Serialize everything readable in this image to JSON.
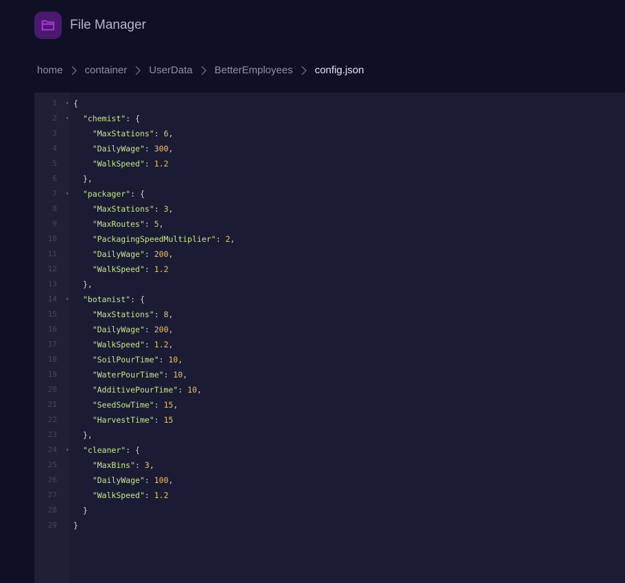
{
  "app": {
    "title": "File Manager",
    "icon": "folder-icon",
    "accent": "#a020c0"
  },
  "breadcrumb": {
    "items": [
      "home",
      "container",
      "UserData",
      "BetterEmployees"
    ],
    "current": "config.json"
  },
  "editor": {
    "lines": [
      {
        "n": "1",
        "fold": true,
        "parts": [
          {
            "t": "p",
            "v": "{"
          }
        ]
      },
      {
        "n": "2",
        "fold": true,
        "parts": [
          {
            "t": "p",
            "v": "  "
          },
          {
            "t": "k",
            "v": "\"chemist\""
          },
          {
            "t": "p",
            "v": ": {"
          }
        ]
      },
      {
        "n": "3",
        "parts": [
          {
            "t": "p",
            "v": "    "
          },
          {
            "t": "k",
            "v": "\"MaxStations\""
          },
          {
            "t": "p",
            "v": ": "
          },
          {
            "t": "n",
            "v": "6"
          },
          {
            "t": "p",
            "v": ","
          }
        ]
      },
      {
        "n": "4",
        "parts": [
          {
            "t": "p",
            "v": "    "
          },
          {
            "t": "k",
            "v": "\"DailyWage\""
          },
          {
            "t": "p",
            "v": ": "
          },
          {
            "t": "n",
            "v": "300"
          },
          {
            "t": "p",
            "v": ","
          }
        ]
      },
      {
        "n": "5",
        "parts": [
          {
            "t": "p",
            "v": "    "
          },
          {
            "t": "k",
            "v": "\"WalkSpeed\""
          },
          {
            "t": "p",
            "v": ": "
          },
          {
            "t": "n",
            "v": "1.2"
          }
        ]
      },
      {
        "n": "6",
        "parts": [
          {
            "t": "p",
            "v": "  },"
          }
        ]
      },
      {
        "n": "7",
        "fold": true,
        "parts": [
          {
            "t": "p",
            "v": "  "
          },
          {
            "t": "k",
            "v": "\"packager\""
          },
          {
            "t": "p",
            "v": ": {"
          }
        ]
      },
      {
        "n": "8",
        "parts": [
          {
            "t": "p",
            "v": "    "
          },
          {
            "t": "k",
            "v": "\"MaxStations\""
          },
          {
            "t": "p",
            "v": ": "
          },
          {
            "t": "n",
            "v": "3"
          },
          {
            "t": "p",
            "v": ","
          }
        ]
      },
      {
        "n": "9",
        "parts": [
          {
            "t": "p",
            "v": "    "
          },
          {
            "t": "k",
            "v": "\"MaxRoutes\""
          },
          {
            "t": "p",
            "v": ": "
          },
          {
            "t": "n",
            "v": "5"
          },
          {
            "t": "p",
            "v": ","
          }
        ]
      },
      {
        "n": "10",
        "parts": [
          {
            "t": "p",
            "v": "    "
          },
          {
            "t": "k",
            "v": "\"PackagingSpeedMultiplier\""
          },
          {
            "t": "p",
            "v": ": "
          },
          {
            "t": "n",
            "v": "2"
          },
          {
            "t": "p",
            "v": ","
          }
        ]
      },
      {
        "n": "11",
        "parts": [
          {
            "t": "p",
            "v": "    "
          },
          {
            "t": "k",
            "v": "\"DailyWage\""
          },
          {
            "t": "p",
            "v": ": "
          },
          {
            "t": "n",
            "v": "200"
          },
          {
            "t": "p",
            "v": ","
          }
        ]
      },
      {
        "n": "12",
        "parts": [
          {
            "t": "p",
            "v": "    "
          },
          {
            "t": "k",
            "v": "\"WalkSpeed\""
          },
          {
            "t": "p",
            "v": ": "
          },
          {
            "t": "n",
            "v": "1.2"
          }
        ]
      },
      {
        "n": "13",
        "parts": [
          {
            "t": "p",
            "v": "  },"
          }
        ]
      },
      {
        "n": "14",
        "fold": true,
        "parts": [
          {
            "t": "p",
            "v": "  "
          },
          {
            "t": "k",
            "v": "\"botanist\""
          },
          {
            "t": "p",
            "v": ": {"
          }
        ]
      },
      {
        "n": "15",
        "parts": [
          {
            "t": "p",
            "v": "    "
          },
          {
            "t": "k",
            "v": "\"MaxStations\""
          },
          {
            "t": "p",
            "v": ": "
          },
          {
            "t": "n",
            "v": "8"
          },
          {
            "t": "p",
            "v": ","
          }
        ]
      },
      {
        "n": "16",
        "parts": [
          {
            "t": "p",
            "v": "    "
          },
          {
            "t": "k",
            "v": "\"DailyWage\""
          },
          {
            "t": "p",
            "v": ": "
          },
          {
            "t": "n",
            "v": "200"
          },
          {
            "t": "p",
            "v": ","
          }
        ]
      },
      {
        "n": "17",
        "parts": [
          {
            "t": "p",
            "v": "    "
          },
          {
            "t": "k",
            "v": "\"WalkSpeed\""
          },
          {
            "t": "p",
            "v": ": "
          },
          {
            "t": "n",
            "v": "1.2"
          },
          {
            "t": "p",
            "v": ","
          }
        ]
      },
      {
        "n": "18",
        "parts": [
          {
            "t": "p",
            "v": "    "
          },
          {
            "t": "k",
            "v": "\"SoilPourTime\""
          },
          {
            "t": "p",
            "v": ": "
          },
          {
            "t": "n",
            "v": "10"
          },
          {
            "t": "p",
            "v": ","
          }
        ]
      },
      {
        "n": "19",
        "parts": [
          {
            "t": "p",
            "v": "    "
          },
          {
            "t": "k",
            "v": "\"WaterPourTime\""
          },
          {
            "t": "p",
            "v": ": "
          },
          {
            "t": "n",
            "v": "10"
          },
          {
            "t": "p",
            "v": ","
          }
        ]
      },
      {
        "n": "20",
        "parts": [
          {
            "t": "p",
            "v": "    "
          },
          {
            "t": "k",
            "v": "\"AdditivePourTime\""
          },
          {
            "t": "p",
            "v": ": "
          },
          {
            "t": "n",
            "v": "10"
          },
          {
            "t": "p",
            "v": ","
          }
        ]
      },
      {
        "n": "21",
        "parts": [
          {
            "t": "p",
            "v": "    "
          },
          {
            "t": "k",
            "v": "\"SeedSowTime\""
          },
          {
            "t": "p",
            "v": ": "
          },
          {
            "t": "n",
            "v": "15"
          },
          {
            "t": "p",
            "v": ","
          }
        ]
      },
      {
        "n": "22",
        "parts": [
          {
            "t": "p",
            "v": "    "
          },
          {
            "t": "k",
            "v": "\"HarvestTime\""
          },
          {
            "t": "p",
            "v": ": "
          },
          {
            "t": "n",
            "v": "15"
          }
        ]
      },
      {
        "n": "23",
        "parts": [
          {
            "t": "p",
            "v": "  },"
          }
        ]
      },
      {
        "n": "24",
        "fold": true,
        "parts": [
          {
            "t": "p",
            "v": "  "
          },
          {
            "t": "k",
            "v": "\"cleaner\""
          },
          {
            "t": "p",
            "v": ": {"
          }
        ]
      },
      {
        "n": "25",
        "parts": [
          {
            "t": "p",
            "v": "    "
          },
          {
            "t": "k",
            "v": "\"MaxBins\""
          },
          {
            "t": "p",
            "v": ": "
          },
          {
            "t": "n",
            "v": "3"
          },
          {
            "t": "p",
            "v": ","
          }
        ]
      },
      {
        "n": "26",
        "parts": [
          {
            "t": "p",
            "v": "    "
          },
          {
            "t": "k",
            "v": "\"DailyWage\""
          },
          {
            "t": "p",
            "v": ": "
          },
          {
            "t": "n",
            "v": "100"
          },
          {
            "t": "p",
            "v": ","
          }
        ]
      },
      {
        "n": "27",
        "parts": [
          {
            "t": "p",
            "v": "    "
          },
          {
            "t": "k",
            "v": "\"WalkSpeed\""
          },
          {
            "t": "p",
            "v": ": "
          },
          {
            "t": "n",
            "v": "1.2"
          }
        ]
      },
      {
        "n": "28",
        "parts": [
          {
            "t": "p",
            "v": "  }"
          }
        ]
      },
      {
        "n": "29",
        "parts": [
          {
            "t": "p",
            "v": "}"
          }
        ]
      }
    ]
  }
}
